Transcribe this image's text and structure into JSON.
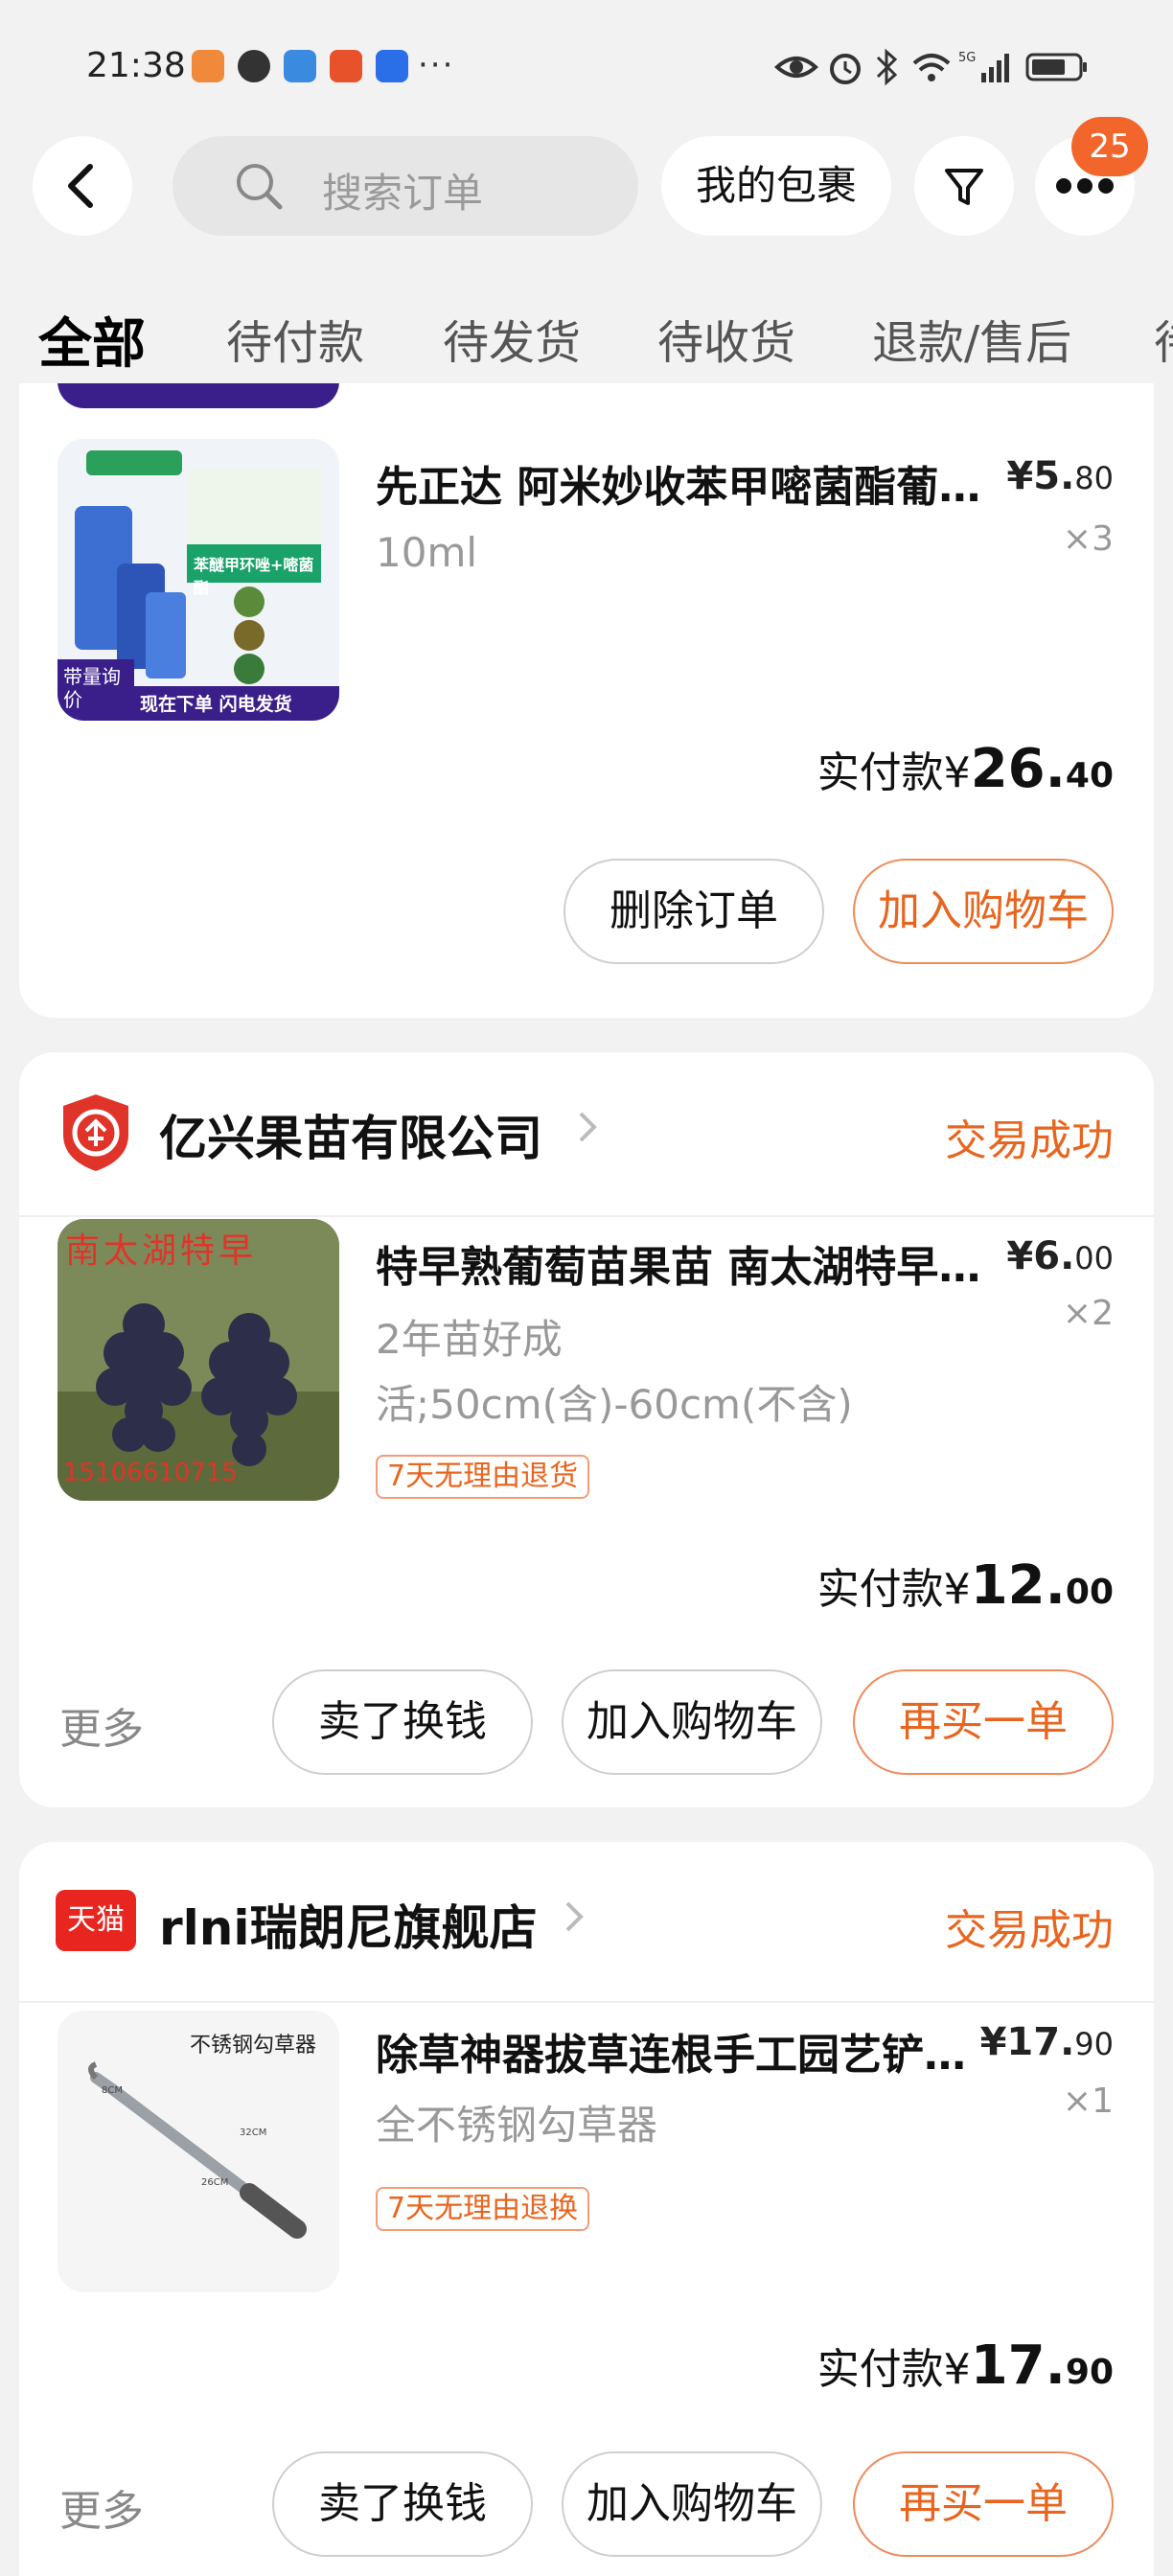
{
  "status": {
    "time": "21:38",
    "more_notifications": "···"
  },
  "header": {
    "search_placeholder": "搜索订单",
    "my_packages": "我的包裹",
    "badge_count": "25"
  },
  "tabs": [
    "全部",
    "待付款",
    "待发货",
    "待收货",
    "退款/售后",
    "待评价"
  ],
  "orders": [
    {
      "product": {
        "title": "先正达 阿米妙收苯甲嘧菌酯葡…",
        "price_int": "5.",
        "price_dec": "80",
        "qty": "×3",
        "sku": "10ml",
        "image_text_1": "苯醚甲环唑+嘧菌酯",
        "image_text_2": "带量询价",
        "image_text_3": "现在下单 闪电发货"
      },
      "paid_label": "实付款¥",
      "paid_int": "26.",
      "paid_dec": "40",
      "buttons": [
        "删除订单",
        "加入购物车"
      ]
    },
    {
      "shop": "亿兴果苗有限公司",
      "status": "交易成功",
      "product": {
        "title": "特早熟葡萄苗果苗 南太湖特早…",
        "price_int": "6.",
        "price_dec": "00",
        "qty": "×2",
        "sku_line1": "2年苗好成",
        "sku_line2": "活;50cm(含)-60cm(不含)",
        "tag": "7天无理由退货",
        "image_text_1": "南太湖特早",
        "image_text_2": "15106610715"
      },
      "paid_label": "实付款¥",
      "paid_int": "12.",
      "paid_dec": "00",
      "more": "更多",
      "buttons": [
        "卖了换钱",
        "加入购物车",
        "再买一单"
      ]
    },
    {
      "shop": "rlni瑞朗尼旗舰店",
      "shop_logo_text": "天猫",
      "status": "交易成功",
      "product": {
        "title": "除草神器拔草连根手工园艺铲…",
        "price_int": "17.",
        "price_dec": "90",
        "qty": "×1",
        "sku": "全不锈钢勾草器",
        "tag": "7天无理由退换",
        "image_text_1": "不锈钢勾草器"
      },
      "paid_label": "实付款¥",
      "paid_int": "17.",
      "paid_dec": "90",
      "more": "更多",
      "buttons": [
        "卖了换钱",
        "加入购物车",
        "再买一单"
      ]
    }
  ],
  "colors": {
    "accent": "#e8651f",
    "badge": "#f3662b",
    "background": "#f2f2f2"
  },
  "icons": [
    "back-icon",
    "search-icon",
    "filter-icon",
    "more-icon",
    "eye-icon",
    "alarm-icon",
    "bluetooth-icon",
    "wifi-icon",
    "signal-icon",
    "battery-icon"
  ]
}
